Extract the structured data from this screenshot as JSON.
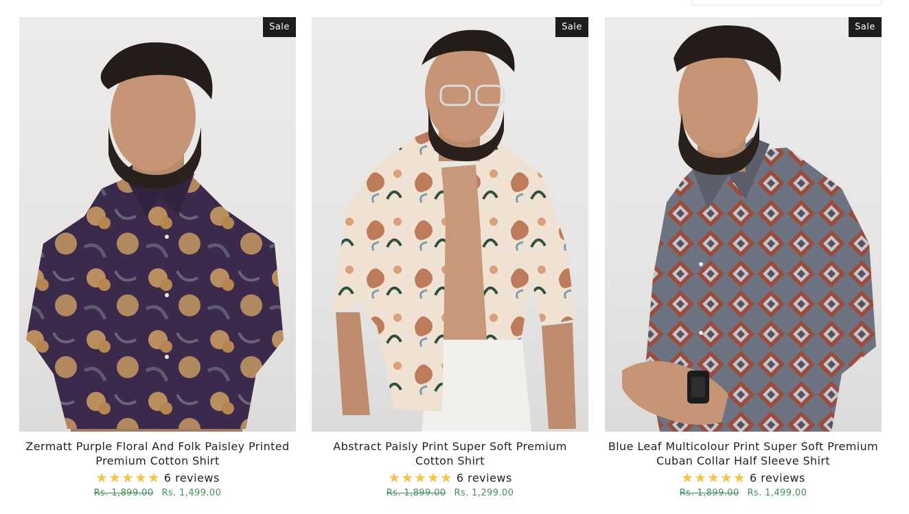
{
  "products": [
    {
      "badge": "Sale",
      "image_alt": "Man in dark purple floral shirt",
      "title": "Zermatt Purple Floral And Folk Paisley Printed Premium Cotton Shirt",
      "rating": 5,
      "reviews": "6 reviews",
      "old_price": "Rs. 1,899.00",
      "new_price": "Rs. 1,499.00",
      "colors": {
        "shirt": "#3b2a4c",
        "pattern": "#c79a62"
      }
    },
    {
      "badge": "Sale",
      "image_alt": "Man in cream paisley print shirt",
      "title": "Abstract Paisly Print Super Soft Premium Cotton Shirt",
      "rating": 5,
      "reviews": "6 reviews",
      "old_price": "Rs. 1,899.00",
      "new_price": "Rs. 1,299.00",
      "colors": {
        "shirt": "#efe2d3",
        "pattern": "#b1613d"
      }
    },
    {
      "badge": "Sale",
      "image_alt": "Man in multicolour geometric print shirt",
      "title": "Blue Leaf Multicolour Print Super Soft Premium Cuban Collar Half Sleeve Shirt",
      "rating": 5,
      "reviews": "6 reviews",
      "old_price": "Rs. 1,899.00",
      "new_price": "Rs. 1,499.00",
      "colors": {
        "shirt": "#6d7380",
        "pattern": "#9b4c3d"
      }
    }
  ],
  "theme": {
    "price_color": "#3f8f54",
    "star_color": "#f6c342",
    "badge_bg": "#1d1d1d"
  }
}
